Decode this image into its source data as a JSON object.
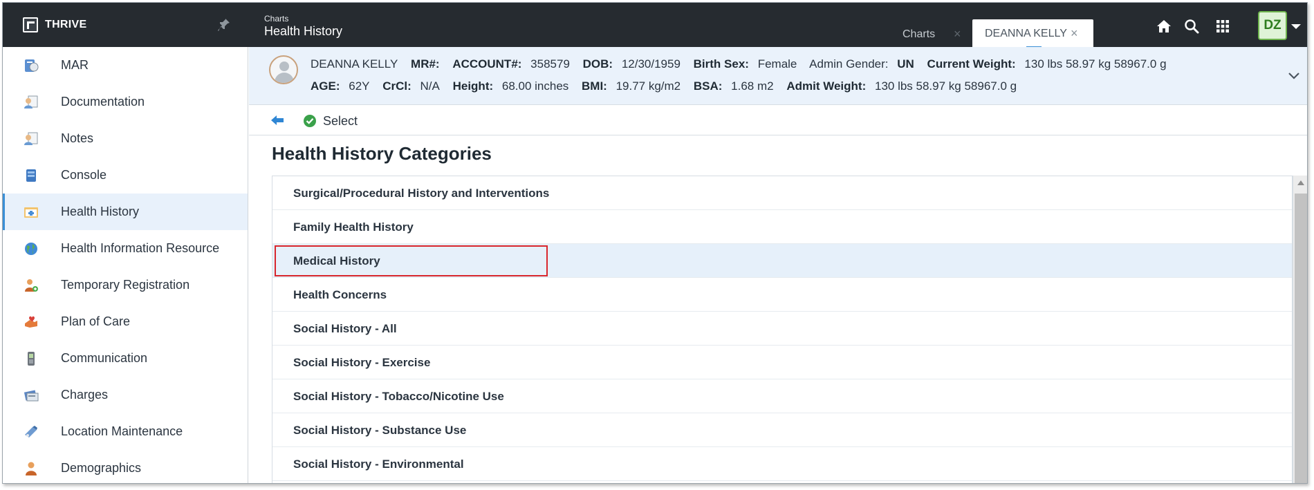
{
  "app": {
    "brand": "THRIVE",
    "breadcrumb_small": "Charts",
    "breadcrumb_title": "Health History",
    "tabs": [
      {
        "label": "Charts",
        "close": "×"
      },
      {
        "label": "DEANNA KELLY",
        "close": "×"
      }
    ],
    "user_initials": "DZ"
  },
  "sidebar": {
    "items": [
      {
        "label": "MAR",
        "icon": "mar-icon"
      },
      {
        "label": "Documentation",
        "icon": "documentation-icon"
      },
      {
        "label": "Notes",
        "icon": "notes-icon"
      },
      {
        "label": "Console",
        "icon": "console-icon"
      },
      {
        "label": "Health History",
        "icon": "health-history-icon",
        "active": true
      },
      {
        "label": "Health Information Resource",
        "icon": "globe-icon"
      },
      {
        "label": "Temporary Registration",
        "icon": "registration-icon"
      },
      {
        "label": "Plan of Care",
        "icon": "plan-of-care-icon"
      },
      {
        "label": "Communication",
        "icon": "phone-icon"
      },
      {
        "label": "Charges",
        "icon": "charges-icon"
      },
      {
        "label": "Location Maintenance",
        "icon": "location-icon"
      },
      {
        "label": "Demographics",
        "icon": "person-icon"
      }
    ]
  },
  "patient": {
    "name": "DEANNA KELLY",
    "mr_label": "MR#:",
    "account_label": "ACCOUNT#:",
    "account": "358579",
    "dob_label": "DOB:",
    "dob": "12/30/1959",
    "birth_sex_label": "Birth Sex:",
    "birth_sex": "Female",
    "admin_gender_label": "Admin Gender:",
    "admin_gender": "UN",
    "current_weight_label": "Current Weight:",
    "current_weight": "130 lbs 58.97 kg 58967.0 g",
    "age_label": "AGE:",
    "age": "62Y",
    "crcl_label": "CrCl:",
    "crcl": "N/A",
    "height_label": "Height:",
    "height": "68.00 inches",
    "bmi_label": "BMI:",
    "bmi": "19.77 kg/m2",
    "bsa_label": "BSA:",
    "bsa": "1.68 m2",
    "admit_weight_label": "Admit Weight:",
    "admit_weight": "130 lbs 58.97 kg 58967.0 g"
  },
  "toolbar": {
    "select_label": "Select"
  },
  "main": {
    "title": "Health History Categories",
    "categories": [
      "Surgical/Procedural History and Interventions",
      "Family Health History",
      "Medical History",
      "Health Concerns",
      "Social History - All",
      "Social History - Exercise",
      "Social History - Tobacco/Nicotine Use",
      "Social History - Substance Use",
      "Social History - Environmental"
    ],
    "selected_index": 2
  },
  "colors": {
    "topbar": "#262b30",
    "accent": "#3a8fd6",
    "banner": "#eaf2fb",
    "selected_row": "#e6f0fa",
    "highlight": "#d9262c"
  }
}
